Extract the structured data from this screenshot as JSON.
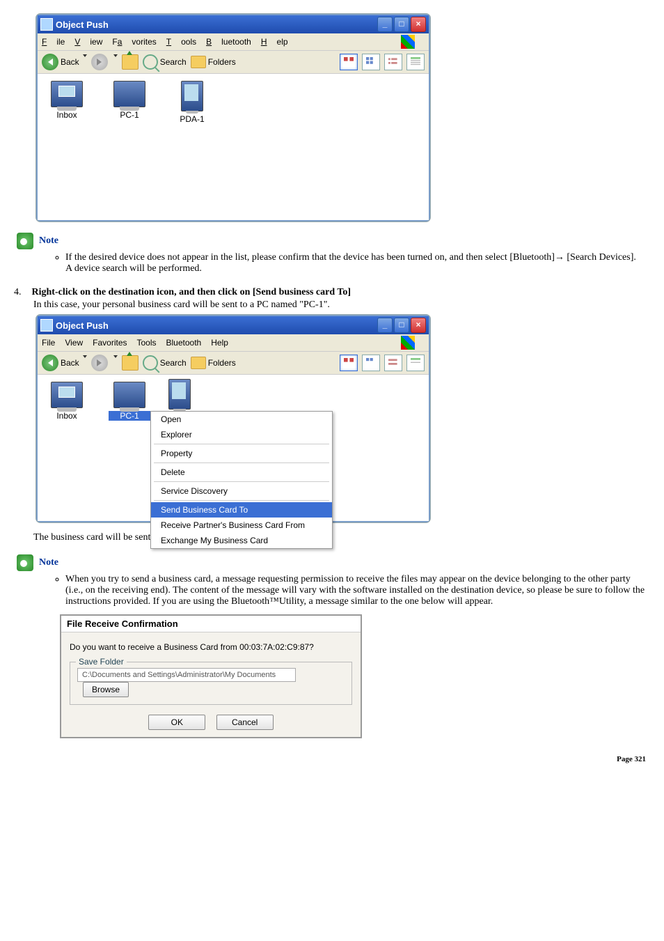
{
  "win1": {
    "title": "Object Push",
    "menu": {
      "file": "File",
      "view": "View",
      "fav": "Favorites",
      "tools": "Tools",
      "bt": "Bluetooth",
      "help": "Help"
    },
    "toolbar": {
      "back": "Back",
      "search": "Search",
      "folders": "Folders"
    },
    "items": {
      "inbox": "Inbox",
      "pc1": "PC-1",
      "pda1": "PDA-1"
    }
  },
  "note1": {
    "title": "Note",
    "text1": "If the desired device does not appear in the list, please confirm that the device has been turned on, and then select [Bluetooth]→ [Search Devices].",
    "text2": "A device search will be performed."
  },
  "step4": {
    "num": "4.",
    "bold": "Right-click on the destination icon, and then click on [Send business card To]",
    "text": "In this case, your personal business card will be sent to a PC named \"PC-1\"."
  },
  "win2": {
    "title": "Object Push",
    "menu": {
      "file": "File",
      "view": "View",
      "fav": "Favorites",
      "tools": "Tools",
      "bt": "Bluetooth",
      "help": "Help"
    },
    "toolbar": {
      "back": "Back",
      "search": "Search",
      "folders": "Folders"
    },
    "items": {
      "inbox": "Inbox",
      "pc1": "PC-1",
      "pda1": "PDA-1"
    },
    "ctx": {
      "open": "Open",
      "explorer": "Explorer",
      "property": "Property",
      "delete": "Delete",
      "sd": "Service Discovery",
      "send": "Send Business Card To",
      "recv": "Receive Partner's Business Card From",
      "exch": "Exchange My Business Card"
    }
  },
  "sent": "The business card will be sent.",
  "note2": {
    "title": "Note",
    "text": "When you try to send a business card, a message requesting permission to receive the files may appear on the device belonging to the other party (i.e., on the receiving end). The content of the message will vary with the software installed on the destination device, so please be sure to follow the instructions provided. If you are using the Bluetooth™Utility, a message similar to the one below will appear."
  },
  "dialog": {
    "title": "File Receive Confirmation",
    "msg": "Do you want to receive a Business Card from 00:03:7A:02:C9:87?",
    "legend": "Save Folder",
    "path": "C:\\Documents and Settings\\Administrator\\My Documents",
    "browse": "Browse",
    "ok": "OK",
    "cancel": "Cancel"
  },
  "page": "Page 321"
}
